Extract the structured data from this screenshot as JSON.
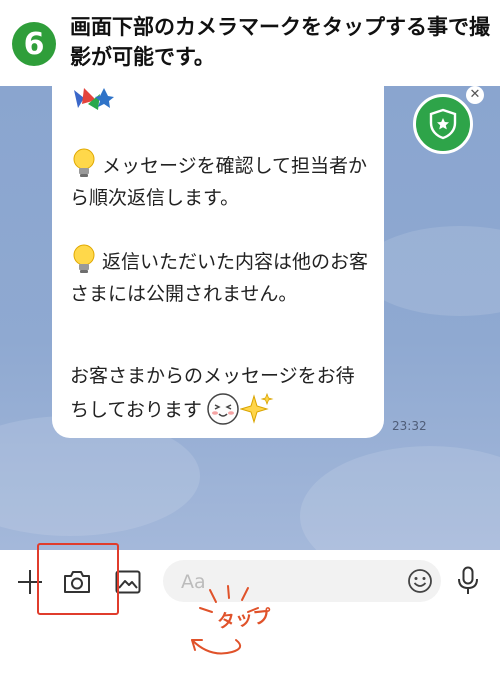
{
  "header": {
    "step_number": "6",
    "instruction": "画面下部のカメラマークをタップする事で撮影が可能です。"
  },
  "chat": {
    "messages": [
      {
        "text": "メッセージを確認して担当者から順次返信します。"
      },
      {
        "text": "返信いただいた内容は他のお客さまには公開されません。"
      },
      {
        "text": "お客さまからのメッセージをお待ちしております"
      }
    ],
    "time": "23:32"
  },
  "input_bar": {
    "placeholder": "Aa"
  },
  "annotation": {
    "tap_label": "タップ"
  },
  "colors": {
    "step_green": "#2f9e3a",
    "chat_background": "#8fa9d1",
    "highlight_red": "#e03c2c",
    "shield_green": "#2ea449"
  }
}
